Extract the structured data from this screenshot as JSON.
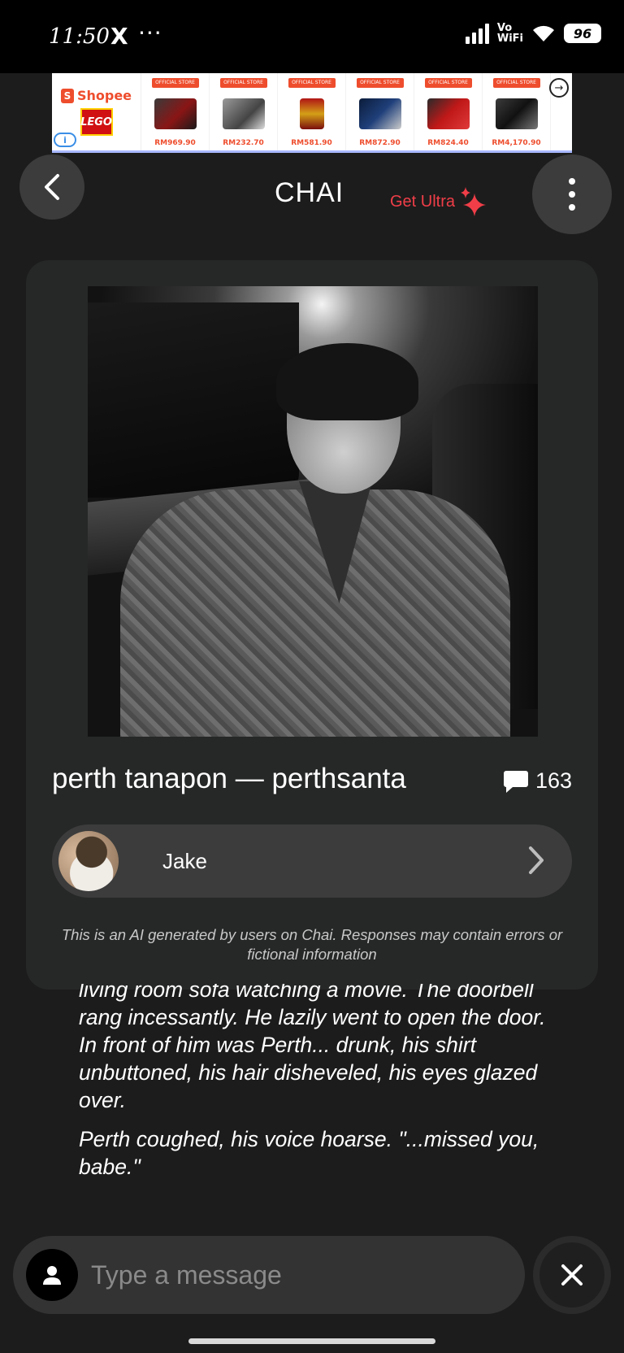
{
  "status_bar": {
    "time": "11:50",
    "x_app": "X",
    "more": "···",
    "network": "Vo\nWiFi",
    "battery": "96"
  },
  "ad": {
    "brand": "Shopee",
    "sub_brand": "LEGO",
    "info": "i",
    "products": [
      {
        "tag": "OFFICIAL STORE",
        "price": "RM969.90"
      },
      {
        "tag": "OFFICIAL STORE",
        "price": "RM232.70"
      },
      {
        "tag": "OFFICIAL STORE",
        "price": "RM581.90"
      },
      {
        "tag": "OFFICIAL STORE",
        "price": "RM872.90"
      },
      {
        "tag": "OFFICIAL STORE",
        "price": "RM824.40"
      },
      {
        "tag": "OFFICIAL STORE",
        "price": "RM4,170.90"
      }
    ]
  },
  "header": {
    "title": "CHAI",
    "get_ultra": "Get Ultra"
  },
  "character": {
    "name": "perth tanapon — perthsanta",
    "message_count": "163",
    "creator": "Jake",
    "disclaimer": "This is an AI generated by users on Chai. Responses may contain errors or fictional information"
  },
  "chat": {
    "paragraphs": [
      "living room sofa watching a movie. The doorbell rang incessantly. He lazily went to open the door. In front of him was Perth... drunk, his shirt unbuttoned, his hair disheveled, his eyes glazed over.",
      "Perth coughed, his voice hoarse. \"...missed you, babe.\""
    ]
  },
  "input": {
    "placeholder": "Type a message"
  },
  "colors": {
    "accent": "#f03e48",
    "background": "#1c1c1c",
    "card": "#262727"
  }
}
